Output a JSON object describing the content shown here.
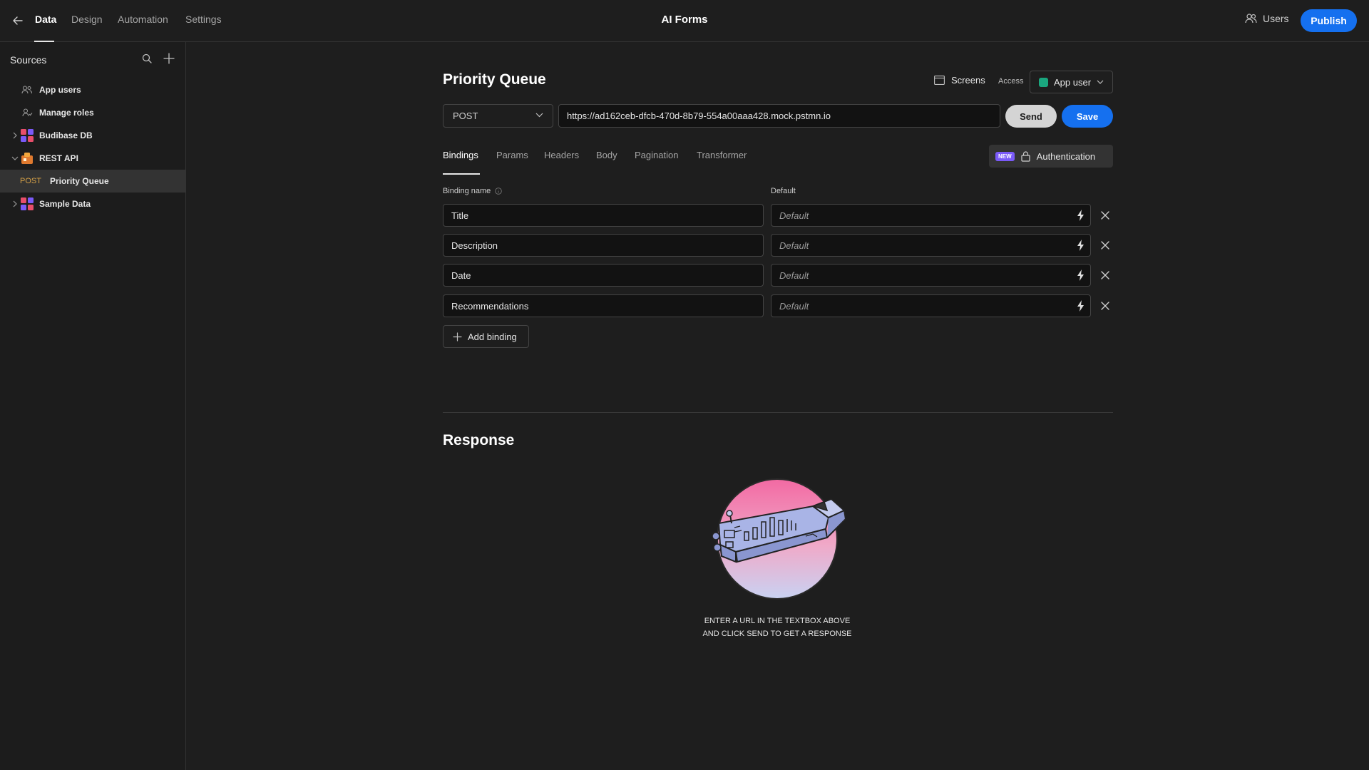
{
  "topbar": {
    "tabs": [
      {
        "label": "Data"
      },
      {
        "label": "Design"
      },
      {
        "label": "Automation"
      },
      {
        "label": "Settings"
      }
    ],
    "app_title": "AI Forms",
    "users_label": "Users",
    "publish_label": "Publish"
  },
  "sidebar": {
    "title": "Sources",
    "items": [
      {
        "label": "App users",
        "icon": "users-icon"
      },
      {
        "label": "Manage roles",
        "icon": "user-role-icon"
      },
      {
        "label": "Budibase DB",
        "icon": "budibase-db-icon"
      },
      {
        "label": "REST API",
        "icon": "rest-api-icon"
      },
      {
        "method": "POST",
        "label": "Priority Queue"
      },
      {
        "label": "Sample Data",
        "icon": "sample-data-icon"
      }
    ]
  },
  "query": {
    "name": "Priority Queue",
    "screens_label": "Screens",
    "access_label": "Access",
    "access_role": "App user",
    "method": "POST",
    "url": "https://ad162ceb-dfcb-470d-8b79-554a00aaa428.mock.pstmn.io",
    "send_label": "Send",
    "save_label": "Save"
  },
  "tabs": [
    {
      "label": "Bindings"
    },
    {
      "label": "Params"
    },
    {
      "label": "Headers"
    },
    {
      "label": "Body"
    },
    {
      "label": "Pagination"
    },
    {
      "label": "Transformer"
    }
  ],
  "auth": {
    "badge": "NEW",
    "label": "Authentication"
  },
  "bindings": {
    "name_header": "Binding name",
    "default_header": "Default",
    "rows": [
      {
        "name": "Title",
        "default_placeholder": "Default"
      },
      {
        "name": "Description",
        "default_placeholder": "Default"
      },
      {
        "name": "Date",
        "default_placeholder": "Default"
      },
      {
        "name": "Recommendations",
        "default_placeholder": "Default"
      }
    ],
    "add_label": "Add binding"
  },
  "response": {
    "heading": "Response",
    "hint_line1": "Enter a URL in the textbox above",
    "hint_line2": "and click send to get a response"
  },
  "colors": {
    "accent": "#1570ef",
    "role_dot": "#1aa67e",
    "new_badge": "#7a5af8",
    "method_post": "#d7a247"
  }
}
